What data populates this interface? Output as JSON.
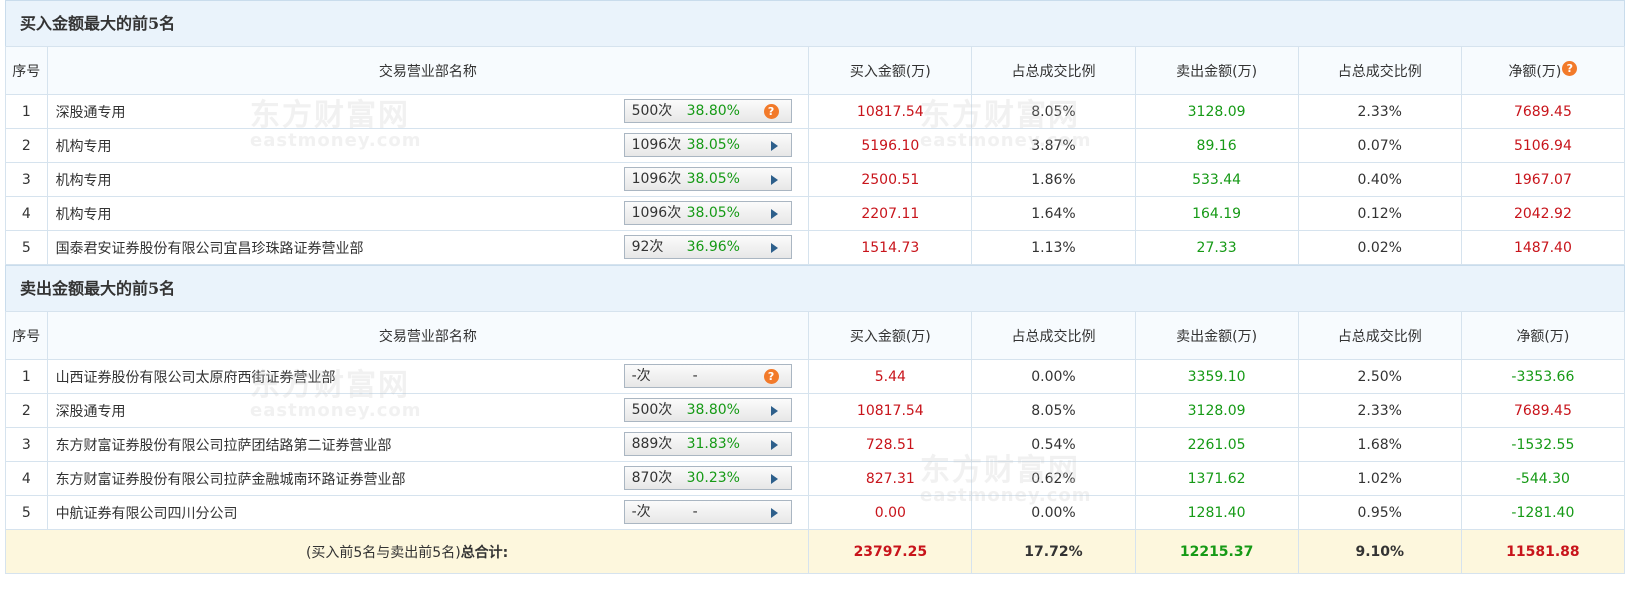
{
  "watermark": {
    "cn": "东方财富网",
    "en": "eastmoney.com"
  },
  "columns": {
    "idx": "序号",
    "dept": "交易营业部名称",
    "buy": "买入金额(万)",
    "buy_pct": "占总成交比例",
    "sell": "卖出金额(万)",
    "sell_pct": "占总成交比例",
    "net": "净额(万)"
  },
  "buy_section": {
    "title": "买入金额最大的前5名",
    "rows": [
      {
        "idx": "1",
        "name": "深股通专用",
        "times": "500次",
        "pct": "38.80%",
        "icon": "question-icon",
        "buy": "10817.54",
        "buy_pct": "8.05%",
        "sell": "3128.09",
        "sell_pct": "2.33%",
        "net": "7689.45"
      },
      {
        "idx": "2",
        "name": "机构专用",
        "times": "1096次",
        "pct": "38.05%",
        "icon": "arrow-right-icon",
        "buy": "5196.10",
        "buy_pct": "3.87%",
        "sell": "89.16",
        "sell_pct": "0.07%",
        "net": "5106.94"
      },
      {
        "idx": "3",
        "name": "机构专用",
        "times": "1096次",
        "pct": "38.05%",
        "icon": "arrow-right-icon",
        "buy": "2500.51",
        "buy_pct": "1.86%",
        "sell": "533.44",
        "sell_pct": "0.40%",
        "net": "1967.07"
      },
      {
        "idx": "4",
        "name": "机构专用",
        "times": "1096次",
        "pct": "38.05%",
        "icon": "arrow-right-icon",
        "buy": "2207.11",
        "buy_pct": "1.64%",
        "sell": "164.19",
        "sell_pct": "0.12%",
        "net": "2042.92"
      },
      {
        "idx": "5",
        "name": "国泰君安证券股份有限公司宜昌珍珠路证券营业部",
        "times": "92次",
        "pct": "36.96%",
        "icon": "arrow-right-icon",
        "buy": "1514.73",
        "buy_pct": "1.13%",
        "sell": "27.33",
        "sell_pct": "0.02%",
        "net": "1487.40"
      }
    ]
  },
  "sell_section": {
    "title": "卖出金额最大的前5名",
    "rows": [
      {
        "idx": "1",
        "name": "山西证券股份有限公司太原府西街证券营业部",
        "times": "-次",
        "pct": "-",
        "icon": "question-icon",
        "buy": "5.44",
        "buy_pct": "0.00%",
        "sell": "3359.10",
        "sell_pct": "2.50%",
        "net": "-3353.66"
      },
      {
        "idx": "2",
        "name": "深股通专用",
        "times": "500次",
        "pct": "38.80%",
        "icon": "arrow-right-icon",
        "buy": "10817.54",
        "buy_pct": "8.05%",
        "sell": "3128.09",
        "sell_pct": "2.33%",
        "net": "7689.45"
      },
      {
        "idx": "3",
        "name": "东方财富证券股份有限公司拉萨团结路第二证券营业部",
        "times": "889次",
        "pct": "31.83%",
        "icon": "arrow-right-icon",
        "buy": "728.51",
        "buy_pct": "0.54%",
        "sell": "2261.05",
        "sell_pct": "1.68%",
        "net": "-1532.55"
      },
      {
        "idx": "4",
        "name": "东方财富证券股份有限公司拉萨金融城南环路证券营业部",
        "times": "870次",
        "pct": "30.23%",
        "icon": "arrow-right-icon",
        "buy": "827.31",
        "buy_pct": "0.62%",
        "sell": "1371.62",
        "sell_pct": "1.02%",
        "net": "-544.30"
      },
      {
        "idx": "5",
        "name": "中航证券有限公司四川分公司",
        "times": "-次",
        "pct": "-",
        "icon": "arrow-right-icon",
        "buy": "0.00",
        "buy_pct": "0.00%",
        "sell": "1281.40",
        "sell_pct": "0.95%",
        "net": "-1281.40"
      }
    ]
  },
  "total": {
    "label_prefix": "(买入前5名与卖出前5名)",
    "label_bold": "总合计:",
    "buy": "23797.25",
    "buy_pct": "17.72%",
    "sell": "12215.37",
    "sell_pct": "9.10%",
    "net": "11581.88"
  },
  "colors": {
    "buy": "#c8141b",
    "sell": "#169a16",
    "header_bg": "#eaf3fb",
    "total_bg": "#fdf7dd"
  }
}
